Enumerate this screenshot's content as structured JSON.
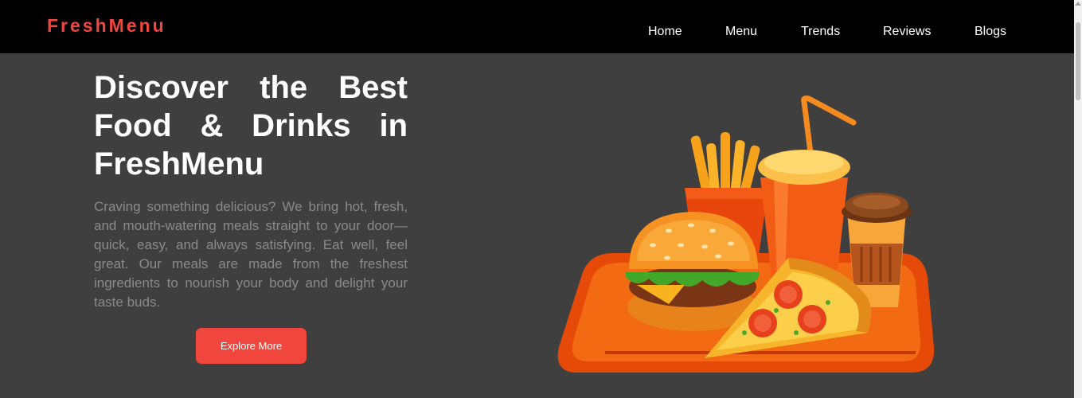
{
  "header": {
    "brand": "FreshMenu",
    "nav": [
      {
        "label": "Home"
      },
      {
        "label": "Menu"
      },
      {
        "label": "Trends"
      },
      {
        "label": "Reviews"
      },
      {
        "label": "Blogs"
      }
    ]
  },
  "hero": {
    "title": "Discover the Best Food & Drinks in FreshMenu",
    "description": "Craving something delicious? We bring hot, fresh, and mouth-watering meals straight to your door—quick, easy, and always satisfying. Eat well, feel great. Our meals are made from the freshest ingredients to nourish your body and delight your taste buds.",
    "cta_label": "Explore More",
    "illustration": "fast-food-tray-icon"
  },
  "colors": {
    "brand": "#f0463d",
    "navbar": "#000000",
    "background": "#3f3f3f",
    "body_text": "#8a8a8a"
  }
}
